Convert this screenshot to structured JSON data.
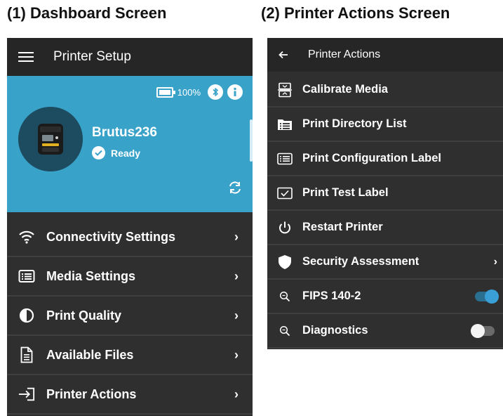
{
  "captions": {
    "left": "(1) Dashboard Screen",
    "right": "(2) Printer Actions Screen"
  },
  "dashboard": {
    "app_title": "Printer Setup",
    "battery_level": "100%",
    "printer_name": "Brutus236",
    "status": "Ready",
    "menu": [
      {
        "label": "Connectivity Settings",
        "icon": "wifi-icon"
      },
      {
        "label": "Media Settings",
        "icon": "list-icon"
      },
      {
        "label": "Print Quality",
        "icon": "contrast-icon"
      },
      {
        "label": "Available Files",
        "icon": "file-icon"
      },
      {
        "label": "Printer Actions",
        "icon": "arrow-into-icon"
      }
    ],
    "colors": {
      "accent": "#39a2c9",
      "background": "#2f2f2f"
    }
  },
  "actions": {
    "title": "Printer Actions",
    "items": [
      {
        "label": "Calibrate Media",
        "icon": "calibrate-icon"
      },
      {
        "label": "Print Directory List",
        "icon": "directory-icon"
      },
      {
        "label": "Print Configuration Label",
        "icon": "config-label-icon"
      },
      {
        "label": "Print Test Label",
        "icon": "test-label-icon"
      },
      {
        "label": "Restart Printer",
        "icon": "power-icon"
      },
      {
        "label": "Security Assessment",
        "icon": "shield-icon"
      },
      {
        "label": "FIPS 140-2",
        "icon": "search-icon",
        "toggle": true
      },
      {
        "label": "Diagnostics",
        "icon": "search-icon",
        "toggle": false
      }
    ],
    "colors": {
      "toggle_on": "#3a9fd6"
    }
  }
}
